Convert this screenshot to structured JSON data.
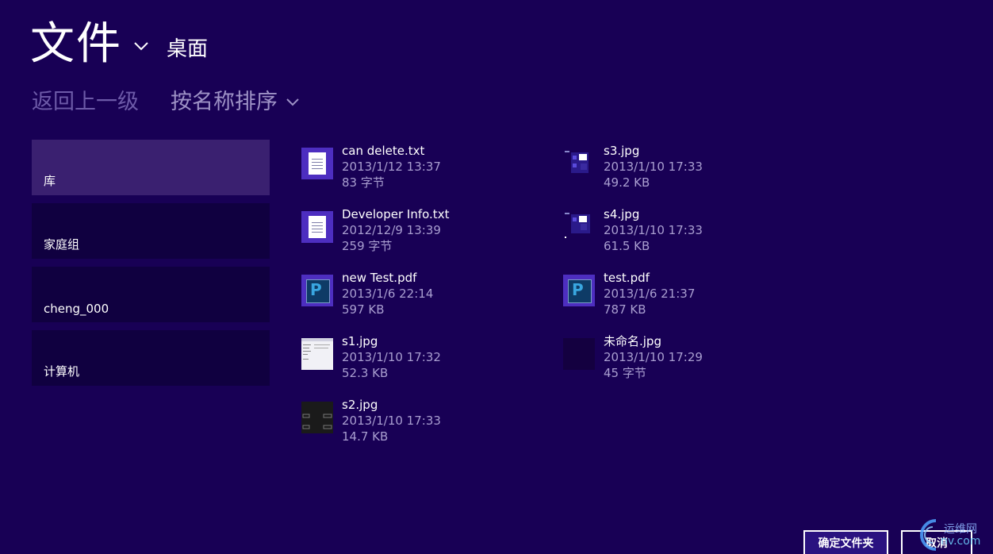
{
  "header": {
    "title": "文件",
    "location": "桌面"
  },
  "toolbar": {
    "back_label": "返回上一级",
    "sort_label": "按名称排序"
  },
  "sidebar": {
    "items": [
      {
        "label": "库",
        "selected": true
      },
      {
        "label": "家庭组",
        "selected": false
      },
      {
        "label": "cheng_000",
        "selected": false
      },
      {
        "label": "计算机",
        "selected": false
      }
    ]
  },
  "files": [
    {
      "name": "can delete.txt",
      "date": "2013/1/12 13:37",
      "size": "83 字节",
      "thumb": "text-file-icon"
    },
    {
      "name": "s3.jpg",
      "date": "2013/1/10 17:33",
      "size": "49.2 KB",
      "thumb": "image-thumbnail"
    },
    {
      "name": "Developer Info.txt",
      "date": "2012/12/9 13:39",
      "size": "259 字节",
      "thumb": "text-file-icon"
    },
    {
      "name": "s4.jpg",
      "date": "2013/1/10 17:33",
      "size": "61.5 KB",
      "thumb": "image-thumbnail"
    },
    {
      "name": "new Test.pdf",
      "date": "2013/1/6 22:14",
      "size": "597 KB",
      "thumb": "pdf-file-icon"
    },
    {
      "name": "test.pdf",
      "date": "2013/1/6 21:37",
      "size": "787 KB",
      "thumb": "pdf-file-icon"
    },
    {
      "name": "s1.jpg",
      "date": "2013/1/10 17:32",
      "size": "52.3 KB",
      "thumb": "image-thumbnail"
    },
    {
      "name": "未命名.jpg",
      "date": "2013/1/10 17:29",
      "size": "45 字节",
      "thumb": "image-thumbnail"
    },
    {
      "name": "s2.jpg",
      "date": "2013/1/10 17:33",
      "size": "14.7 KB",
      "thumb": "image-thumbnail"
    }
  ],
  "buttons": {
    "confirm_label": "确定文件夹",
    "cancel_label": "取消"
  },
  "watermark": {
    "line1": "运维网",
    "line2": "nv.com"
  },
  "colors": {
    "background": "#180055",
    "selected_item": "#3a2070",
    "item": "#100040",
    "secondary_text": "#a99ed0",
    "accent_tile": "#4d2ec0"
  }
}
